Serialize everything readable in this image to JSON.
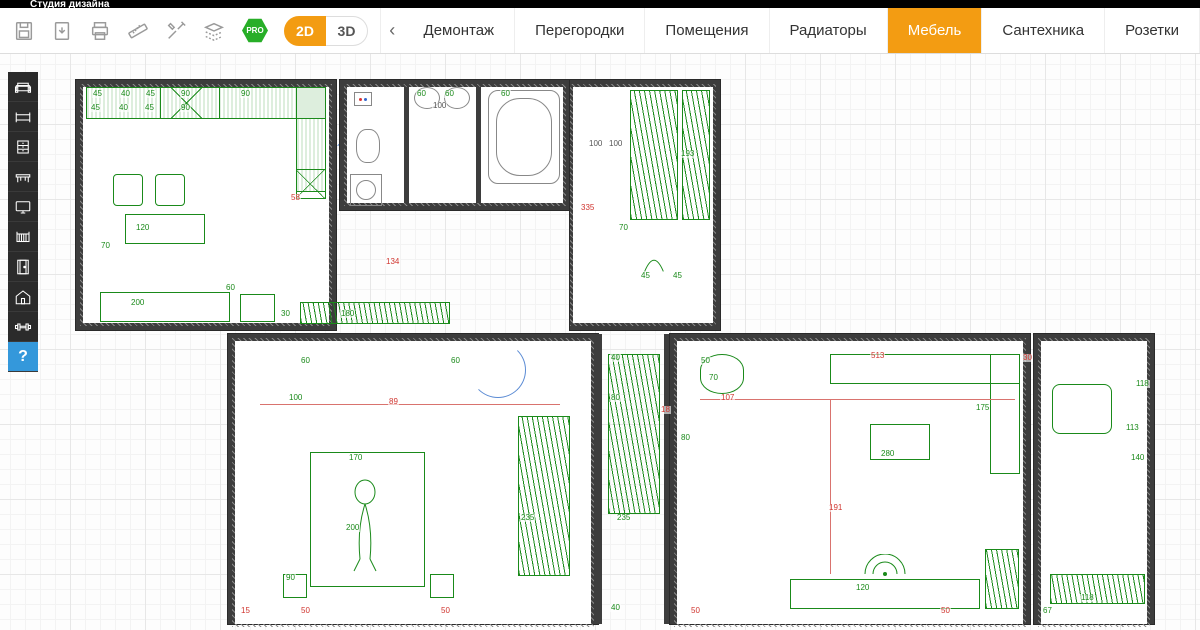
{
  "app_title": "Студия дизайна",
  "toolbar": {
    "save_title": "Сохранить",
    "import_title": "Импорт",
    "print_title": "Печать",
    "measure_title": "Линейка",
    "tools_title": "Инструменты",
    "layers_title": "Слои",
    "pro_label": "PRO",
    "view2d": "2D",
    "view3d": "3D",
    "view_active": "2D",
    "prev_arrow": "‹"
  },
  "tabs": {
    "items": [
      {
        "id": "demolition",
        "label": "Демонтаж"
      },
      {
        "id": "walls",
        "label": "Перегородки"
      },
      {
        "id": "rooms",
        "label": "Помещения"
      },
      {
        "id": "radiators",
        "label": "Радиаторы"
      },
      {
        "id": "furniture",
        "label": "Мебель"
      },
      {
        "id": "plumbing",
        "label": "Сантехника"
      },
      {
        "id": "sockets",
        "label": "Розетки"
      }
    ],
    "active": "furniture"
  },
  "sidebar": {
    "icons": [
      "sofa",
      "bed",
      "dresser",
      "table",
      "tv",
      "crib",
      "door",
      "house",
      "dumbbell"
    ],
    "help": "?"
  },
  "plan": {
    "dimensions_green": [
      "45",
      "40",
      "45",
      "90",
      "90",
      "45",
      "40",
      "45",
      "90",
      "60",
      "60",
      "100",
      "60",
      "193",
      "70",
      "100",
      "100",
      "120",
      "70",
      "200",
      "134",
      "60",
      "30",
      "180",
      "60",
      "40",
      "100",
      "89",
      "60",
      "80",
      "170",
      "200",
      "90",
      "15",
      "50",
      "50",
      "235",
      "235",
      "80",
      "40",
      "45",
      "45",
      "50",
      "107",
      "18",
      "50",
      "280",
      "175",
      "191",
      "70",
      "120",
      "50",
      "67",
      "118",
      "140",
      "118",
      "113",
      "513",
      "30"
    ],
    "dimensions_red": [
      "58",
      "335",
      "134",
      "89",
      "107",
      "18",
      "191",
      "513",
      "15",
      "50",
      "50",
      "50"
    ],
    "dimensions_grey": [
      "100",
      "100",
      "60"
    ]
  }
}
